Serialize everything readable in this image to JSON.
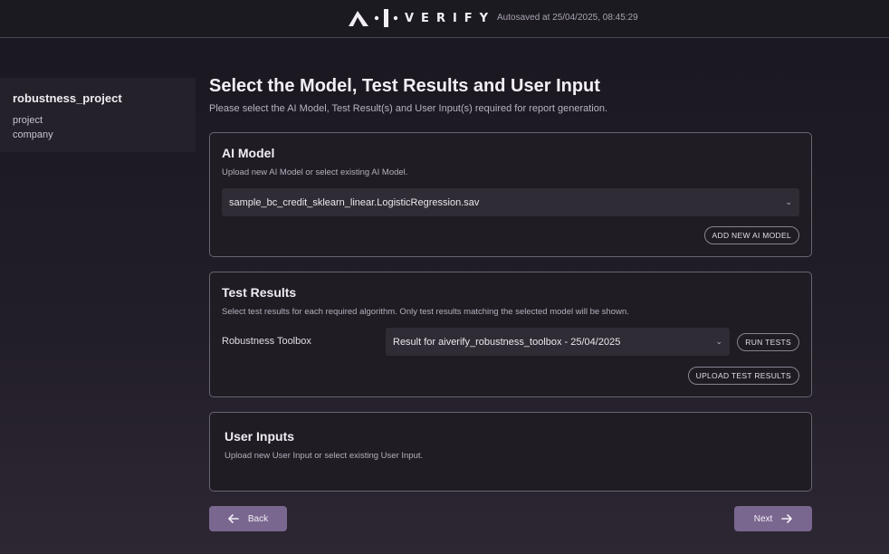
{
  "header": {
    "logo_text": "VERIFY",
    "autosave": "Autosaved at 25/04/2025, 08:45:29"
  },
  "sidebar": {
    "project_name": "robustness_project",
    "meta": [
      "project",
      "company"
    ]
  },
  "page": {
    "title": "Select the Model, Test Results and User Input",
    "subtitle": "Please select the AI Model, Test Result(s) and User Input(s) required for report generation."
  },
  "ai_model": {
    "title": "AI Model",
    "description": "Upload new AI Model or select existing AI Model.",
    "selected": "sample_bc_credit_sklearn_linear.LogisticRegression.sav",
    "add_button": "ADD NEW AI MODEL"
  },
  "test_results": {
    "title": "Test Results",
    "description": "Select test results for each required algorithm. Only test results matching the selected model will be shown.",
    "algorithm_label": "Robustness Toolbox",
    "selected": "Result for aiverify_robustness_toolbox - 25/04/2025",
    "run_button": "RUN TESTS",
    "upload_button": "UPLOAD TEST RESULTS"
  },
  "user_inputs": {
    "title": "User Inputs",
    "description": "Upload new User Input or select existing User Input."
  },
  "nav": {
    "back_label": "Back",
    "next_label": "Next"
  }
}
